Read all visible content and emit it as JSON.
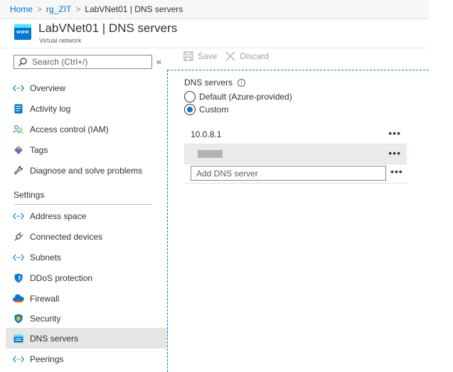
{
  "breadcrumb": {
    "items": [
      "Home",
      "rg_ZIT",
      "LabVNet01 | DNS servers"
    ],
    "separator": ">"
  },
  "header": {
    "icon_text": "www",
    "title": "LabVNet01 | DNS servers",
    "subtitle": "Virtual network"
  },
  "sidebar": {
    "search_placeholder": "Search (Ctrl+/)",
    "collapse_glyph": "«",
    "items": [
      {
        "label": "Overview",
        "icon": "overview-icon"
      },
      {
        "label": "Activity log",
        "icon": "activity-log-icon"
      },
      {
        "label": "Access control (IAM)",
        "icon": "iam-icon"
      },
      {
        "label": "Tags",
        "icon": "tag-icon"
      },
      {
        "label": "Diagnose and solve problems",
        "icon": "wrench-icon"
      }
    ],
    "settings_heading": "Settings",
    "settings_items": [
      {
        "label": "Address space",
        "icon": "address-space-icon"
      },
      {
        "label": "Connected devices",
        "icon": "plug-icon"
      },
      {
        "label": "Subnets",
        "icon": "subnets-icon"
      },
      {
        "label": "DDoS protection",
        "icon": "shield-icon"
      },
      {
        "label": "Firewall",
        "icon": "firewall-icon"
      },
      {
        "label": "Security",
        "icon": "security-shield-icon"
      },
      {
        "label": "DNS servers",
        "icon": "dns-icon",
        "selected": true
      },
      {
        "label": "Peerings",
        "icon": "peerings-icon"
      }
    ]
  },
  "toolbar": {
    "save_label": "Save",
    "discard_label": "Discard"
  },
  "dns": {
    "label": "DNS servers",
    "info_glyph": "i",
    "options": [
      {
        "label": "Default (Azure-provided)",
        "checked": false
      },
      {
        "label": "Custom",
        "checked": true
      }
    ],
    "servers": [
      "10.0.8.1",
      ""
    ],
    "more_glyph": "•••",
    "add_placeholder": "Add DNS server"
  },
  "colors": {
    "accent": "#0078d4",
    "selected_bg": "#e5e5e5",
    "disabled_text": "#a19f9d"
  }
}
